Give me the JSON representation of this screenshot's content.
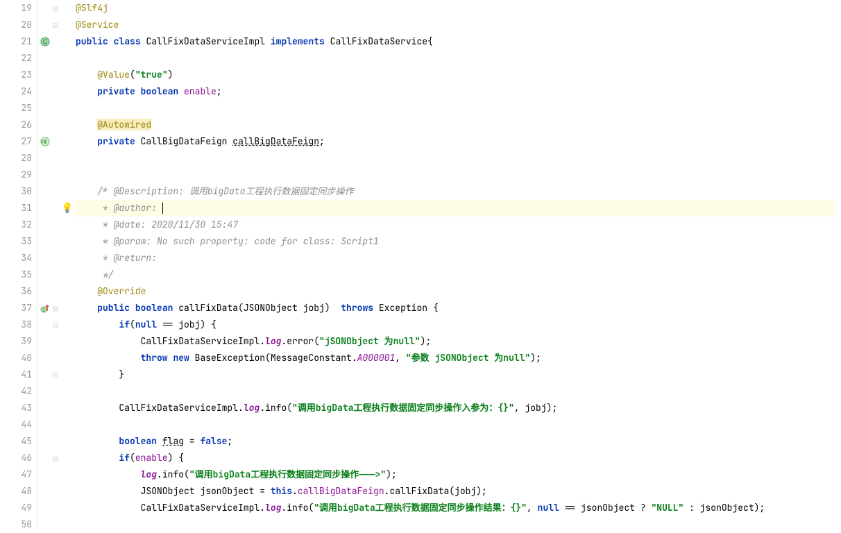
{
  "lines": {
    "19": {
      "num": "19",
      "indent": "",
      "tokens": [
        {
          "t": "@Slf4j",
          "c": "ann"
        }
      ]
    },
    "20": {
      "num": "20",
      "indent": "",
      "tokens": [
        {
          "t": "@Service",
          "c": "ann"
        }
      ]
    },
    "21": {
      "num": "21",
      "indent": "",
      "tokens": [
        {
          "t": "public",
          "c": "kw"
        },
        {
          "t": " ",
          "c": ""
        },
        {
          "t": "class",
          "c": "kw"
        },
        {
          "t": " CallFixDataServiceImpl ",
          "c": "cls"
        },
        {
          "t": "implements",
          "c": "kw"
        },
        {
          "t": " CallFixDataService{",
          "c": "cls"
        }
      ]
    },
    "22": {
      "num": "22",
      "indent": "",
      "tokens": []
    },
    "23": {
      "num": "23",
      "indent": "    ",
      "tokens": [
        {
          "t": "@Value",
          "c": "ann"
        },
        {
          "t": "(",
          "c": "paren"
        },
        {
          "t": "\"true\"",
          "c": "str"
        },
        {
          "t": ")",
          "c": "paren"
        }
      ]
    },
    "24": {
      "num": "24",
      "indent": "    ",
      "tokens": [
        {
          "t": "private",
          "c": "kw"
        },
        {
          "t": " ",
          "c": ""
        },
        {
          "t": "boolean",
          "c": "kw"
        },
        {
          "t": " ",
          "c": ""
        },
        {
          "t": "enable",
          "c": "fld-purple"
        },
        {
          "t": ";",
          "c": ""
        }
      ]
    },
    "25": {
      "num": "25",
      "indent": "",
      "tokens": []
    },
    "26": {
      "num": "26",
      "indent": "    ",
      "tokens": [
        {
          "t": "@Autowired",
          "c": "ann-hl"
        }
      ]
    },
    "27": {
      "num": "27",
      "indent": "    ",
      "tokens": [
        {
          "t": "private",
          "c": "kw"
        },
        {
          "t": " CallBigDataFeign ",
          "c": "cls"
        },
        {
          "t": "callBigDataFeign",
          "c": "var-underline fld-purple"
        },
        {
          "t": ";",
          "c": ""
        }
      ]
    },
    "28": {
      "num": "28",
      "indent": "",
      "tokens": []
    },
    "29": {
      "num": "29",
      "indent": "",
      "tokens": []
    },
    "30": {
      "num": "30",
      "indent": "    ",
      "tokens": [
        {
          "t": "/* @Description: 调用bigData工程执行数据固定同步操作",
          "c": "cmt"
        }
      ]
    },
    "31": {
      "num": "31",
      "indent": "    ",
      "tokens": [
        {
          "t": " * @author: ",
          "c": "cmt"
        }
      ],
      "highlight": true,
      "caret": true
    },
    "32": {
      "num": "32",
      "indent": "    ",
      "tokens": [
        {
          "t": " * @date: 2020/11/30 15:47",
          "c": "cmt"
        }
      ]
    },
    "33": {
      "num": "33",
      "indent": "    ",
      "tokens": [
        {
          "t": " * @param: No such property: code for class: Script1",
          "c": "cmt"
        }
      ]
    },
    "34": {
      "num": "34",
      "indent": "    ",
      "tokens": [
        {
          "t": " * @return:",
          "c": "cmt"
        }
      ]
    },
    "35": {
      "num": "35",
      "indent": "    ",
      "tokens": [
        {
          "t": " */",
          "c": "cmt"
        }
      ]
    },
    "36": {
      "num": "36",
      "indent": "    ",
      "tokens": [
        {
          "t": "@Override",
          "c": "ann"
        }
      ]
    },
    "37": {
      "num": "37",
      "indent": "    ",
      "tokens": [
        {
          "t": "public",
          "c": "kw"
        },
        {
          "t": " ",
          "c": ""
        },
        {
          "t": "boolean",
          "c": "kw"
        },
        {
          "t": " callFixData(JSONObject jobj)  ",
          "c": "mtd"
        },
        {
          "t": "throws",
          "c": "kw"
        },
        {
          "t": " Exception {",
          "c": ""
        }
      ]
    },
    "38": {
      "num": "38",
      "indent": "        ",
      "tokens": [
        {
          "t": "if",
          "c": "kw"
        },
        {
          "t": "(",
          "c": ""
        },
        {
          "t": "null",
          "c": "kw"
        },
        {
          "t": " == jobj) {",
          "c": ""
        }
      ]
    },
    "39": {
      "num": "39",
      "indent": "            ",
      "tokens": [
        {
          "t": "CallFixDataServiceImpl.",
          "c": ""
        },
        {
          "t": "log",
          "c": "fld-italic"
        },
        {
          "t": ".error(",
          "c": ""
        },
        {
          "t": "\"jSONObject 为null\"",
          "c": "str"
        },
        {
          "t": ");",
          "c": ""
        }
      ]
    },
    "40": {
      "num": "40",
      "indent": "            ",
      "tokens": [
        {
          "t": "throw",
          "c": "kw"
        },
        {
          "t": " ",
          "c": ""
        },
        {
          "t": "new",
          "c": "kw"
        },
        {
          "t": " BaseException(MessageConstant.",
          "c": ""
        },
        {
          "t": "A000001",
          "c": "static-fld"
        },
        {
          "t": ", ",
          "c": ""
        },
        {
          "t": "\"参数 jSONObject 为null\"",
          "c": "str"
        },
        {
          "t": ");",
          "c": ""
        }
      ]
    },
    "41": {
      "num": "41",
      "indent": "        ",
      "tokens": [
        {
          "t": "}",
          "c": ""
        }
      ]
    },
    "42": {
      "num": "42",
      "indent": "",
      "tokens": []
    },
    "43": {
      "num": "43",
      "indent": "        ",
      "tokens": [
        {
          "t": "CallFixDataServiceImpl.",
          "c": ""
        },
        {
          "t": "log",
          "c": "fld-italic"
        },
        {
          "t": ".info(",
          "c": ""
        },
        {
          "t": "\"调用bigData工程执行数据固定同步操作入参为：{}\"",
          "c": "str"
        },
        {
          "t": ", jobj);",
          "c": ""
        }
      ]
    },
    "44": {
      "num": "44",
      "indent": "",
      "tokens": []
    },
    "45": {
      "num": "45",
      "indent": "        ",
      "tokens": [
        {
          "t": "boolean",
          "c": "kw"
        },
        {
          "t": " ",
          "c": ""
        },
        {
          "t": "flag",
          "c": "var-underline"
        },
        {
          "t": " = ",
          "c": ""
        },
        {
          "t": "false",
          "c": "kw"
        },
        {
          "t": ";",
          "c": ""
        }
      ]
    },
    "46": {
      "num": "46",
      "indent": "        ",
      "tokens": [
        {
          "t": "if",
          "c": "kw"
        },
        {
          "t": "(",
          "c": ""
        },
        {
          "t": "enable",
          "c": "fld-purple"
        },
        {
          "t": ") {",
          "c": ""
        }
      ]
    },
    "47": {
      "num": "47",
      "indent": "            ",
      "tokens": [
        {
          "t": "log",
          "c": "fld-italic"
        },
        {
          "t": ".info(",
          "c": ""
        },
        {
          "t": "\"调用bigData工程执行数据固定同步操作———>\"",
          "c": "str"
        },
        {
          "t": ");",
          "c": ""
        }
      ]
    },
    "48": {
      "num": "48",
      "indent": "            ",
      "tokens": [
        {
          "t": "JSONObject jsonObject = ",
          "c": ""
        },
        {
          "t": "this",
          "c": "kw"
        },
        {
          "t": ".",
          "c": ""
        },
        {
          "t": "callBigDataFeign",
          "c": "fld-purple"
        },
        {
          "t": ".callFixData(jobj);",
          "c": ""
        }
      ]
    },
    "49": {
      "num": "49",
      "indent": "            ",
      "tokens": [
        {
          "t": "CallFixDataServiceImpl.",
          "c": ""
        },
        {
          "t": "log",
          "c": "fld-italic"
        },
        {
          "t": ".info(",
          "c": ""
        },
        {
          "t": "\"调用bigData工程执行数据固定同步操作结果：{}\"",
          "c": "str"
        },
        {
          "t": ", ",
          "c": ""
        },
        {
          "t": "null",
          "c": "kw"
        },
        {
          "t": " == jsonObject ? ",
          "c": ""
        },
        {
          "t": "\"NULL\"",
          "c": "str"
        },
        {
          "t": " : jsonObject);",
          "c": ""
        }
      ]
    },
    "50": {
      "num": "50",
      "indent": "",
      "tokens": []
    }
  },
  "lineOrder": [
    "19",
    "20",
    "21",
    "22",
    "23",
    "24",
    "25",
    "26",
    "27",
    "28",
    "29",
    "30",
    "31",
    "32",
    "33",
    "34",
    "35",
    "36",
    "37",
    "38",
    "39",
    "40",
    "41",
    "42",
    "43",
    "44",
    "45",
    "46",
    "47",
    "48",
    "49",
    "50"
  ],
  "markers": {
    "21": "class-icon",
    "27": "bean-icon",
    "37": "impl-up-icon"
  },
  "folds": {
    "19": "expand",
    "20": "expand",
    "37": "expand",
    "38": "expand",
    "41": "collapse",
    "46": "expand"
  },
  "bulb": {
    "line": "31",
    "icon": "💡"
  }
}
